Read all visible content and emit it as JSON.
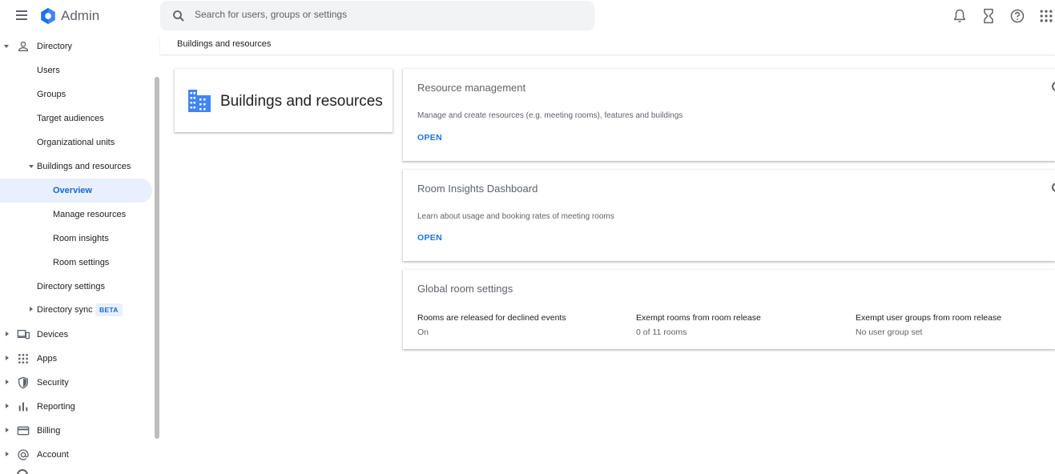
{
  "app": {
    "title": "Admin"
  },
  "search": {
    "placeholder": "Search for users, groups or settings"
  },
  "topbar": {
    "icons": [
      "notifications-icon",
      "hourglass-icon",
      "help-icon",
      "apps-grid-icon"
    ]
  },
  "sidebar": {
    "directory": "Directory",
    "users": "Users",
    "groups": "Groups",
    "target_audiences": "Target audiences",
    "org_units": "Organizational units",
    "buildings": "Buildings and resources",
    "overview": "Overview",
    "manage_resources": "Manage resources",
    "room_insights": "Room insights",
    "room_settings": "Room settings",
    "directory_settings": "Directory settings",
    "directory_sync": "Directory sync",
    "beta": "BETA",
    "devices": "Devices",
    "apps": "Apps",
    "security": "Security",
    "reporting": "Reporting",
    "billing": "Billing",
    "account": "Account"
  },
  "breadcrumb": "Buildings and resources",
  "main": {
    "title": "Buildings and resources",
    "resource_management": {
      "title": "Resource management",
      "desc": "Manage and create resources (e.g. meeting rooms), features and buildings",
      "action": "OPEN"
    },
    "room_insights": {
      "title": "Room Insights Dashboard",
      "desc": "Learn about usage and booking rates of meeting rooms",
      "action": "OPEN"
    },
    "global_settings": {
      "title": "Global room settings",
      "items": [
        {
          "name": "Rooms are released for declined events",
          "value": "On"
        },
        {
          "name": "Exempt rooms from room release",
          "value": "0 of 11 rooms"
        },
        {
          "name": "Exempt user groups from room release",
          "value": "No user group set"
        }
      ]
    }
  },
  "colors": {
    "accent": "#1a73e8",
    "active_bg": "#e8f0fe",
    "icon": "#5f6368"
  }
}
